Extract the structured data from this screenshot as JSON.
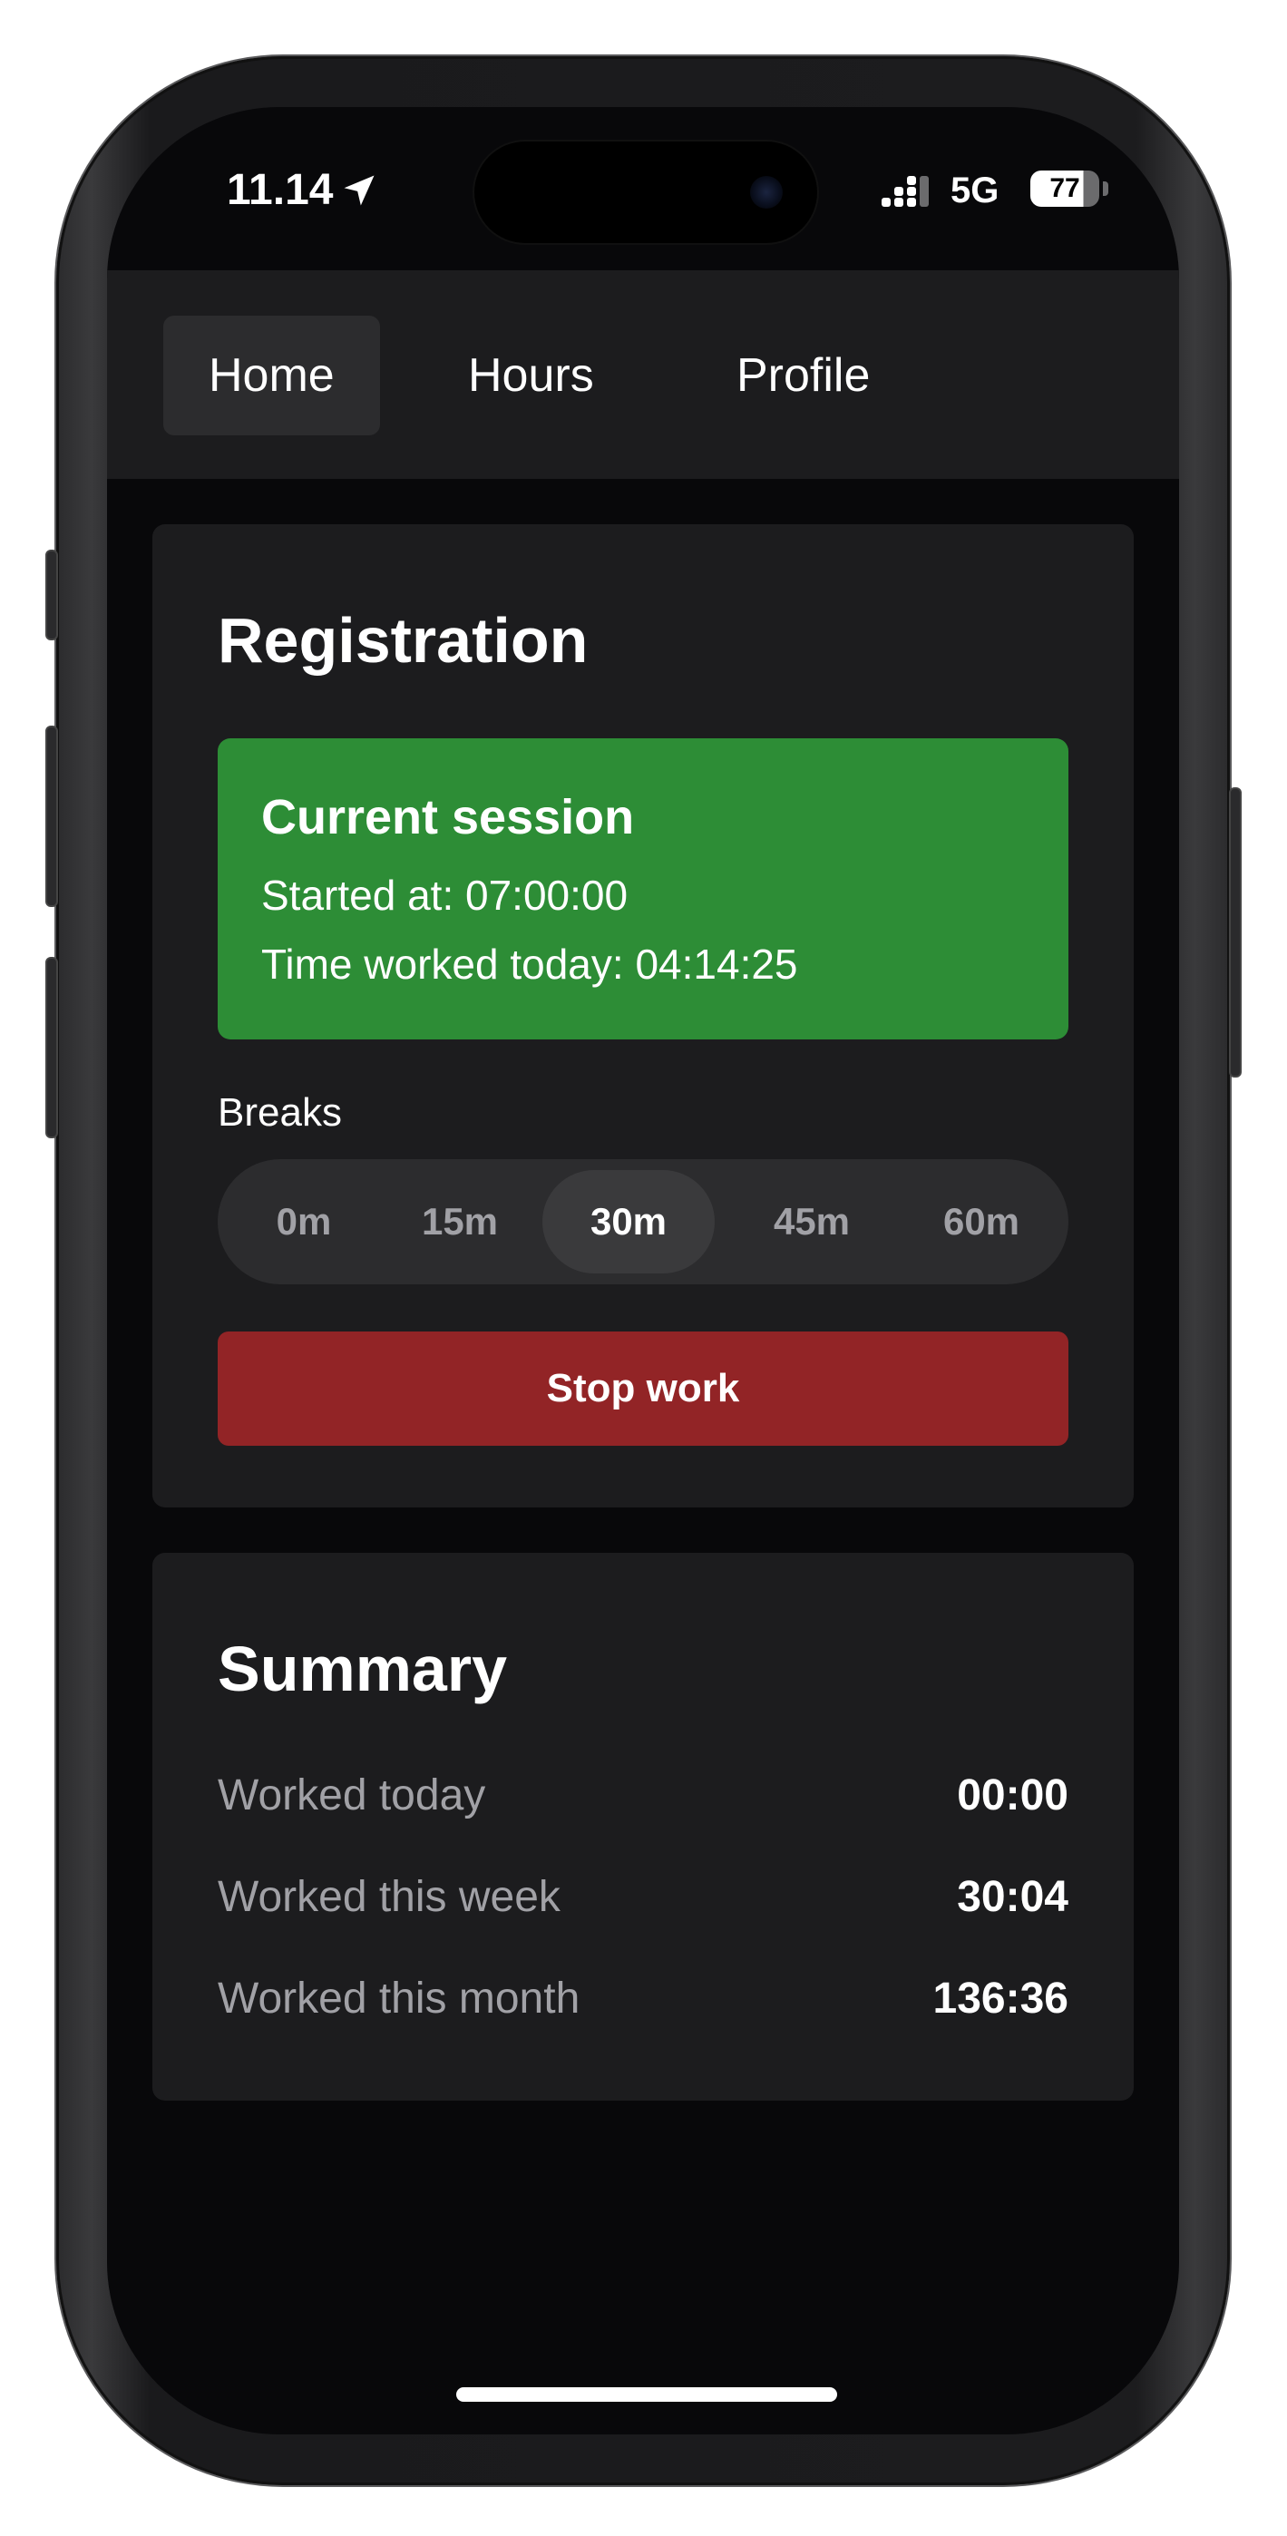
{
  "status_bar": {
    "time": "11.14",
    "network": "5G",
    "battery_level": "77",
    "icons": [
      "location-arrow-icon",
      "signal-icon",
      "battery-icon"
    ]
  },
  "nav": {
    "tabs": [
      {
        "label": "Home",
        "active": true
      },
      {
        "label": "Hours",
        "active": false
      },
      {
        "label": "Profile",
        "active": false
      }
    ]
  },
  "registration": {
    "title": "Registration",
    "session": {
      "title": "Current session",
      "started": "Started at: 07:00:00",
      "worked": "Time worked today: 04:14:25"
    },
    "breaks_label": "Breaks",
    "break_options": [
      "0m",
      "15m",
      "30m",
      "45m",
      "60m"
    ],
    "selected_break": "30m",
    "stop_label": "Stop work"
  },
  "summary": {
    "title": "Summary",
    "rows": [
      {
        "label": "Worked today",
        "value": "00:00"
      },
      {
        "label": "Worked this week",
        "value": "30:04"
      },
      {
        "label": "Worked this month",
        "value": "136:36"
      }
    ]
  },
  "colors": {
    "session_green": "#2d8d36",
    "stop_red": "#922426",
    "card_bg": "#1c1c1e",
    "screen_bg": "#08080a"
  }
}
